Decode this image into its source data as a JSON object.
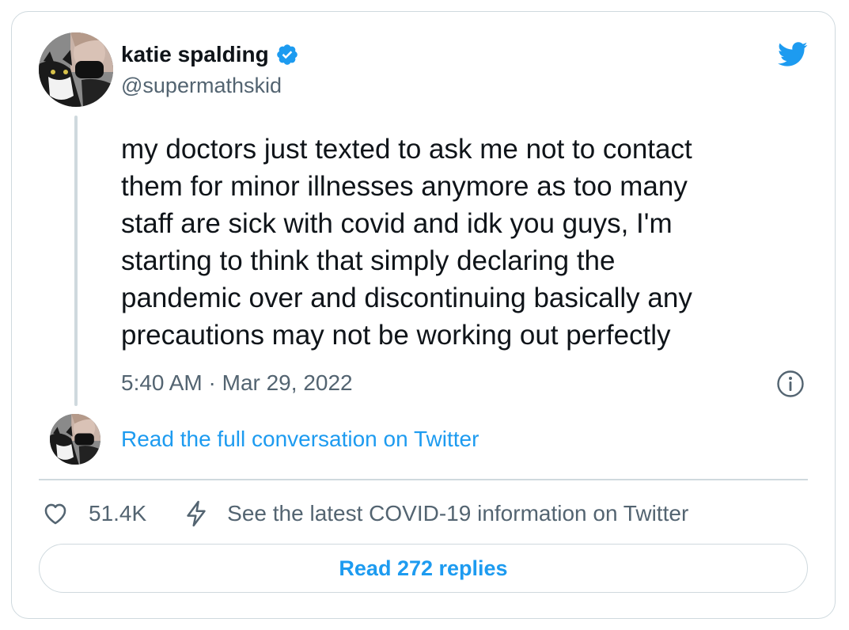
{
  "author": {
    "name": "katie spalding",
    "handle": "@supermathskid",
    "verified": true
  },
  "tweet": {
    "text": "my doctors just texted to ask me not to contact\nthem for minor illnesses anymore as too many\nstaff are sick with covid and idk you guys, I'm\nstarting to think that simply declaring the\npandemic over and discontinuing basically any\nprecautions may not be working out perfectly",
    "timestamp": "5:40 AM · Mar 29, 2022"
  },
  "conversation_link": "Read the full conversation on Twitter",
  "actions": {
    "like_count": "51.4K",
    "covid_info": "See the latest COVID-19 information on Twitter"
  },
  "replies_button": "Read 272 replies",
  "icons": {
    "logo": "twitter-bird-icon",
    "verified": "verified-badge-icon",
    "info": "info-icon",
    "like": "heart-icon",
    "covid": "lightning-bolt-icon"
  },
  "colors": {
    "accent": "#1d9bf0",
    "text": "#0f1419",
    "secondary": "#536471",
    "border": "#cfd9de"
  }
}
